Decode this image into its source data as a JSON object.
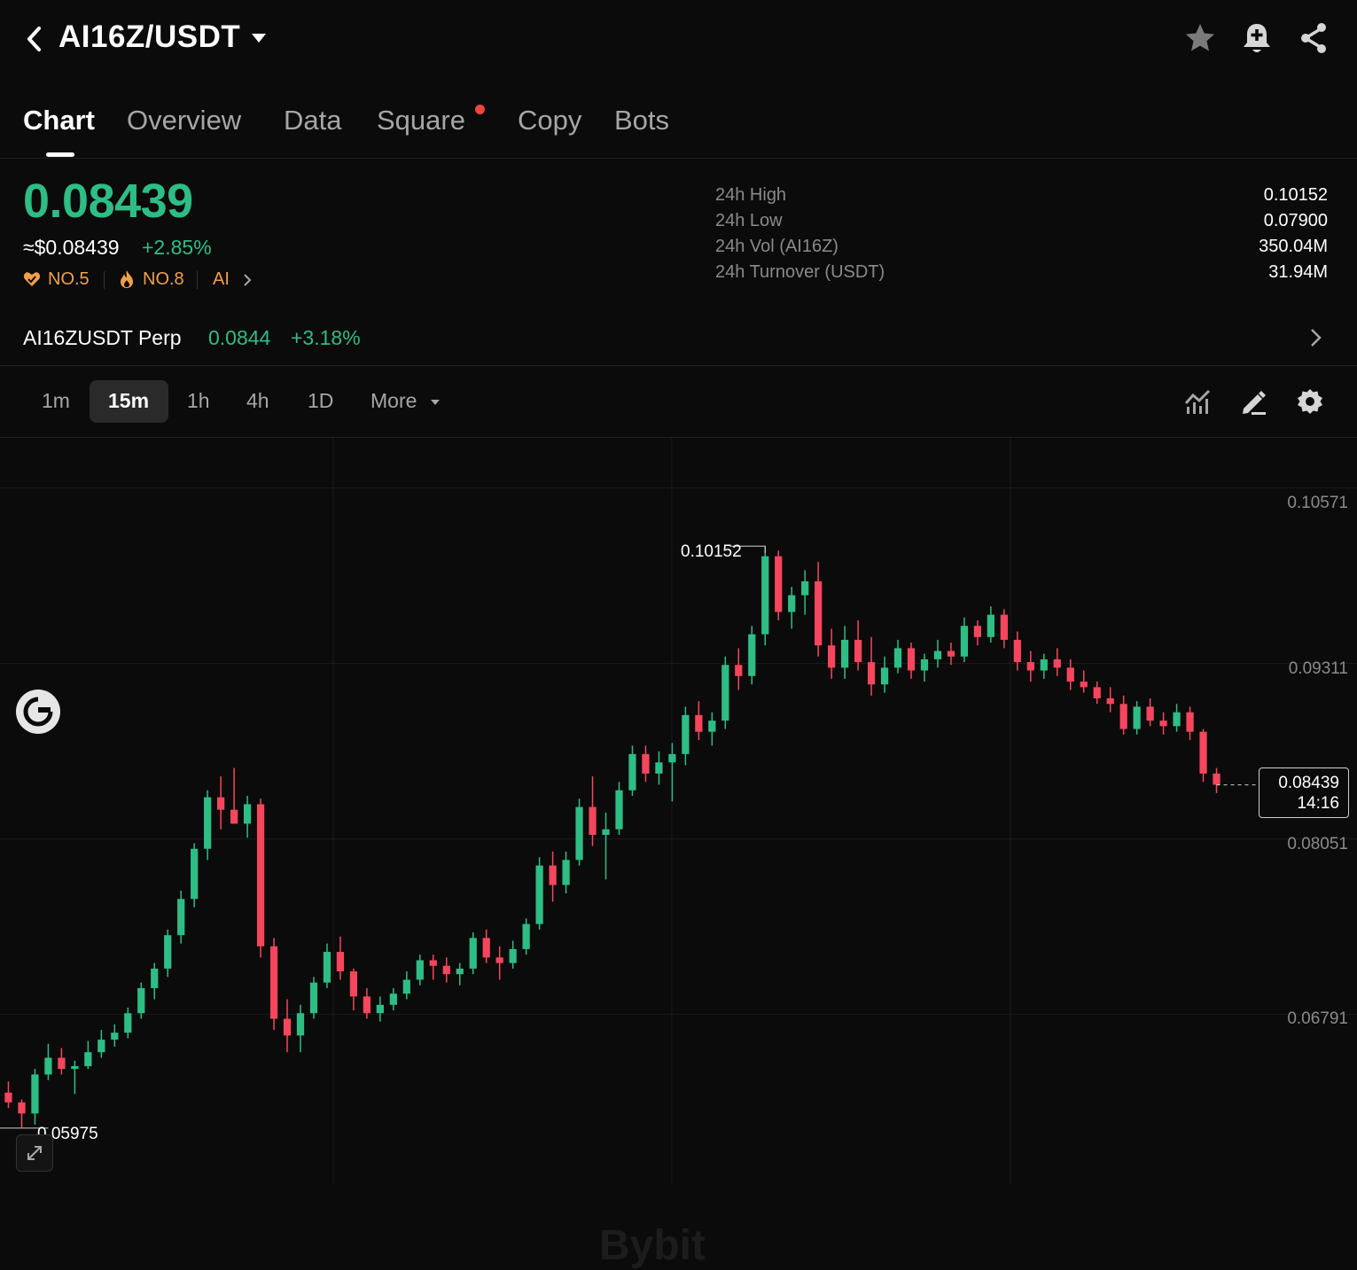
{
  "header": {
    "pair": "AI16Z/USDT",
    "icons": [
      "back-chevron-icon",
      "dropdown-caret-icon",
      "star-icon",
      "bell-plus-icon",
      "share-icon"
    ]
  },
  "tabs": [
    {
      "label": "Chart",
      "active": true
    },
    {
      "label": "Overview",
      "active": false
    },
    {
      "label": "Data",
      "active": false
    },
    {
      "label": "Square",
      "active": false,
      "badge_dot": true
    },
    {
      "label": "Copy",
      "active": false
    },
    {
      "label": "Bots",
      "active": false
    }
  ],
  "ticker": {
    "price": "0.08439",
    "usd_price": "≈$0.08439",
    "change_pct": "+2.85%",
    "ranks": [
      {
        "icon": "heart-badge-icon",
        "label": "NO.5"
      },
      {
        "icon": "flame-icon",
        "label": "NO.8"
      },
      {
        "icon": "",
        "label": "AI"
      }
    ]
  },
  "stats": [
    {
      "label": "24h High",
      "value": "0.10152"
    },
    {
      "label": "24h Low",
      "value": "0.07900"
    },
    {
      "label": "24h Vol (AI16Z)",
      "value": "350.04M"
    },
    {
      "label": "24h Turnover (USDT)",
      "value": "31.94M"
    }
  ],
  "perp": {
    "name": "AI16ZUSDT Perp",
    "price": "0.0844",
    "change": "+3.18%"
  },
  "timeframes": {
    "items": [
      "1m",
      "15m",
      "1h",
      "4h",
      "1D"
    ],
    "active": "15m",
    "more_label": "More",
    "tool_icons": [
      "indicators-icon",
      "draw-pen-icon",
      "settings-gear-icon"
    ]
  },
  "chart": {
    "y_ticks": [
      "0.10571",
      "0.09311",
      "0.08051",
      "0.06791"
    ],
    "high_marker": "0.10152",
    "low_marker": "0.05975",
    "last_price": "0.08439",
    "countdown": "14:16",
    "watermark": "Bybit",
    "colors": {
      "up": "#2ebd85",
      "down": "#f6465d",
      "accent": "#2ebd85"
    }
  },
  "chart_data": {
    "type": "candlestick",
    "interval": "15m",
    "ylim": [
      0.0558,
      0.1093
    ],
    "y_ticks": [
      0.10571,
      0.09311,
      0.08051,
      0.06791
    ],
    "high": 0.10152,
    "low": 0.05975,
    "last": 0.08439,
    "candles": [
      [
        0.0623,
        0.0631,
        0.0612,
        0.0616
      ],
      [
        0.0616,
        0.0618,
        0.0598,
        0.0608
      ],
      [
        0.0608,
        0.064,
        0.06,
        0.0636
      ],
      [
        0.0636,
        0.0658,
        0.0632,
        0.0648
      ],
      [
        0.0648,
        0.0655,
        0.0636,
        0.064
      ],
      [
        0.064,
        0.0646,
        0.0622,
        0.0642
      ],
      [
        0.0642,
        0.066,
        0.064,
        0.0652
      ],
      [
        0.0652,
        0.0668,
        0.0648,
        0.0661
      ],
      [
        0.0661,
        0.0672,
        0.0656,
        0.0666
      ],
      [
        0.0666,
        0.0684,
        0.0662,
        0.068
      ],
      [
        0.068,
        0.0702,
        0.0676,
        0.0698
      ],
      [
        0.0698,
        0.0716,
        0.069,
        0.0712
      ],
      [
        0.0712,
        0.074,
        0.0706,
        0.0736
      ],
      [
        0.0736,
        0.0768,
        0.073,
        0.0762
      ],
      [
        0.0762,
        0.0802,
        0.0756,
        0.0798
      ],
      [
        0.0798,
        0.084,
        0.079,
        0.0835
      ],
      [
        0.0835,
        0.085,
        0.0812,
        0.0826
      ],
      [
        0.0826,
        0.0856,
        0.0818,
        0.0816
      ],
      [
        0.0816,
        0.0836,
        0.0806,
        0.083
      ],
      [
        0.083,
        0.0834,
        0.072,
        0.0728
      ],
      [
        0.0728,
        0.0734,
        0.0668,
        0.0676
      ],
      [
        0.0676,
        0.069,
        0.0652,
        0.0664
      ],
      [
        0.0664,
        0.0686,
        0.0652,
        0.068
      ],
      [
        0.068,
        0.0706,
        0.0676,
        0.0702
      ],
      [
        0.0702,
        0.073,
        0.0698,
        0.0724
      ],
      [
        0.0724,
        0.0735,
        0.0704,
        0.071
      ],
      [
        0.071,
        0.0712,
        0.0682,
        0.0692
      ],
      [
        0.0692,
        0.0698,
        0.0676,
        0.068
      ],
      [
        0.068,
        0.0692,
        0.0674,
        0.0686
      ],
      [
        0.0686,
        0.0698,
        0.0682,
        0.0694
      ],
      [
        0.0694,
        0.071,
        0.069,
        0.0704
      ],
      [
        0.0704,
        0.0722,
        0.07,
        0.0718
      ],
      [
        0.0718,
        0.0722,
        0.0704,
        0.0714
      ],
      [
        0.0714,
        0.072,
        0.0702,
        0.0708
      ],
      [
        0.0708,
        0.0716,
        0.07,
        0.0712
      ],
      [
        0.0712,
        0.0738,
        0.0708,
        0.0734
      ],
      [
        0.0734,
        0.074,
        0.0716,
        0.072
      ],
      [
        0.072,
        0.0728,
        0.0704,
        0.0716
      ],
      [
        0.0716,
        0.0732,
        0.0712,
        0.0726
      ],
      [
        0.0726,
        0.0748,
        0.0722,
        0.0744
      ],
      [
        0.0744,
        0.0792,
        0.074,
        0.0786
      ],
      [
        0.0786,
        0.0796,
        0.076,
        0.0772
      ],
      [
        0.0772,
        0.0796,
        0.0766,
        0.079
      ],
      [
        0.079,
        0.0834,
        0.0786,
        0.0828
      ],
      [
        0.0828,
        0.085,
        0.08,
        0.0808
      ],
      [
        0.0808,
        0.0824,
        0.0776,
        0.0812
      ],
      [
        0.0812,
        0.0846,
        0.0808,
        0.084
      ],
      [
        0.084,
        0.0872,
        0.0836,
        0.0866
      ],
      [
        0.0866,
        0.0872,
        0.0846,
        0.0852
      ],
      [
        0.0852,
        0.0868,
        0.0844,
        0.086
      ],
      [
        0.086,
        0.0874,
        0.0832,
        0.0866
      ],
      [
        0.0866,
        0.09,
        0.0858,
        0.0894
      ],
      [
        0.0894,
        0.0904,
        0.0876,
        0.0882
      ],
      [
        0.0882,
        0.0896,
        0.0872,
        0.089
      ],
      [
        0.089,
        0.0936,
        0.0884,
        0.093
      ],
      [
        0.093,
        0.0942,
        0.0912,
        0.0922
      ],
      [
        0.0922,
        0.0958,
        0.0916,
        0.0952
      ],
      [
        0.0952,
        0.1015,
        0.0944,
        0.1008
      ],
      [
        0.1008,
        0.1012,
        0.0962,
        0.0968
      ],
      [
        0.0968,
        0.0986,
        0.0956,
        0.098
      ],
      [
        0.098,
        0.0998,
        0.0966,
        0.099
      ],
      [
        0.099,
        0.1004,
        0.0936,
        0.0944
      ],
      [
        0.0944,
        0.0956,
        0.092,
        0.0928
      ],
      [
        0.0928,
        0.0958,
        0.092,
        0.0948
      ],
      [
        0.0948,
        0.0962,
        0.0926,
        0.0932
      ],
      [
        0.0932,
        0.095,
        0.0908,
        0.0916
      ],
      [
        0.0916,
        0.0936,
        0.091,
        0.0928
      ],
      [
        0.0928,
        0.0948,
        0.0924,
        0.0942
      ],
      [
        0.0942,
        0.0946,
        0.092,
        0.0926
      ],
      [
        0.0926,
        0.0938,
        0.0918,
        0.0934
      ],
      [
        0.0934,
        0.0948,
        0.0928,
        0.094
      ],
      [
        0.094,
        0.0946,
        0.093,
        0.0936
      ],
      [
        0.0936,
        0.0964,
        0.0932,
        0.0958
      ],
      [
        0.0958,
        0.0962,
        0.0944,
        0.095
      ],
      [
        0.095,
        0.0972,
        0.0946,
        0.0966
      ],
      [
        0.0966,
        0.097,
        0.0942,
        0.0948
      ],
      [
        0.0948,
        0.0954,
        0.0926,
        0.0932
      ],
      [
        0.0932,
        0.094,
        0.0918,
        0.0926
      ],
      [
        0.0926,
        0.0938,
        0.092,
        0.0934
      ],
      [
        0.0934,
        0.0942,
        0.0922,
        0.0928
      ],
      [
        0.0928,
        0.0934,
        0.0912,
        0.0918
      ],
      [
        0.0918,
        0.0926,
        0.091,
        0.0914
      ],
      [
        0.0914,
        0.0918,
        0.0902,
        0.0906
      ],
      [
        0.0906,
        0.0914,
        0.0896,
        0.0902
      ],
      [
        0.0902,
        0.0908,
        0.088,
        0.0884
      ],
      [
        0.0884,
        0.0904,
        0.088,
        0.09
      ],
      [
        0.09,
        0.0906,
        0.0886,
        0.089
      ],
      [
        0.089,
        0.0896,
        0.088,
        0.0886
      ],
      [
        0.0886,
        0.0902,
        0.0882,
        0.0896
      ],
      [
        0.0896,
        0.09,
        0.0876,
        0.0882
      ],
      [
        0.0882,
        0.0884,
        0.0846,
        0.0852
      ],
      [
        0.0852,
        0.0856,
        0.0838,
        0.0844
      ]
    ]
  }
}
